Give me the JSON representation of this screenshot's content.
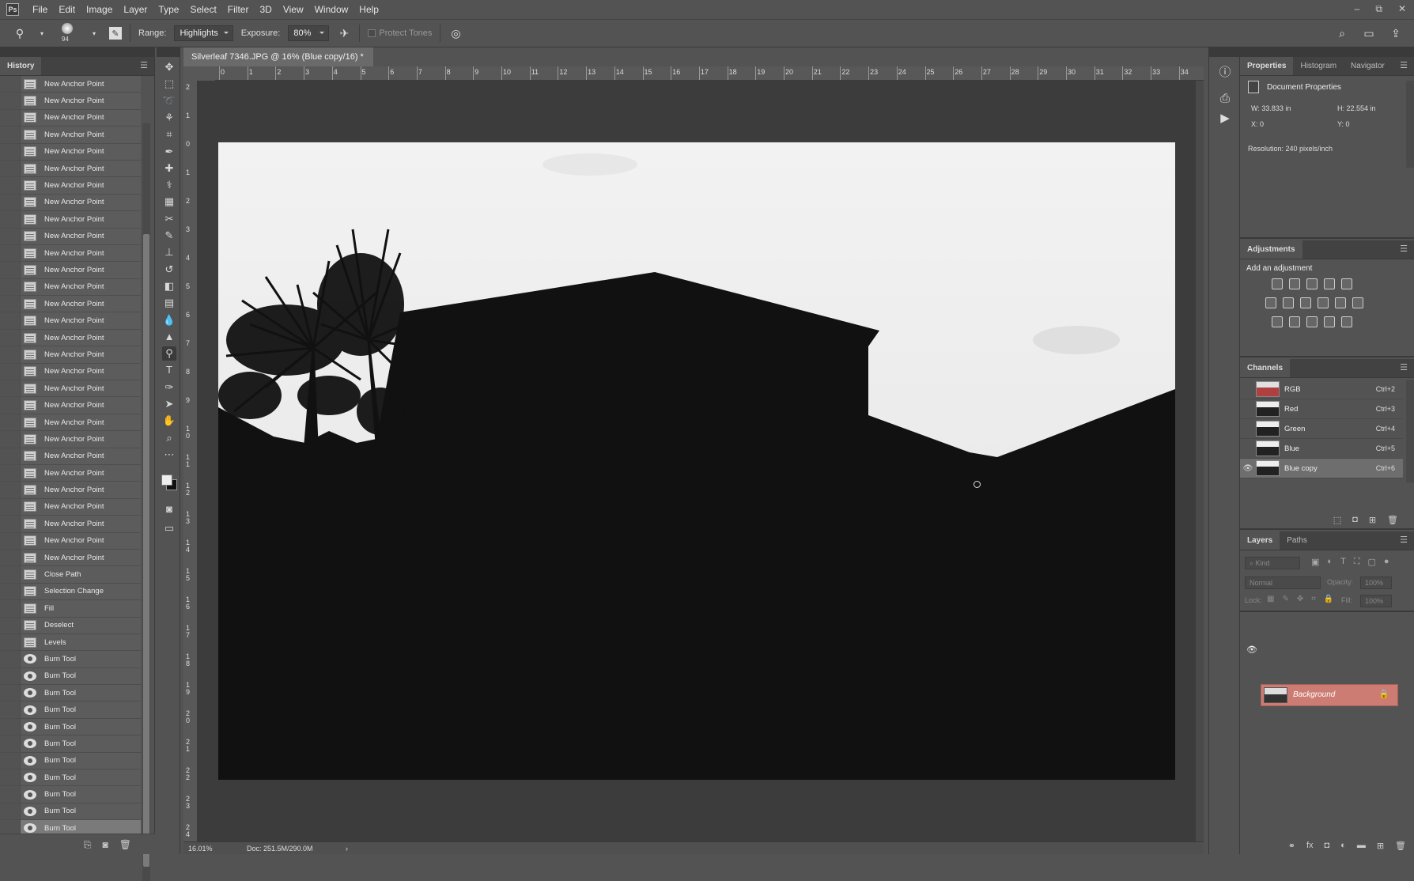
{
  "menubar": {
    "logo": "Ps",
    "items": [
      "File",
      "Edit",
      "Image",
      "Layer",
      "Type",
      "Select",
      "Filter",
      "3D",
      "View",
      "Window",
      "Help"
    ],
    "window_controls": [
      "–",
      "⧉",
      "✕"
    ]
  },
  "options": {
    "brush_size": "94",
    "range_label": "Range:",
    "range_value": "Highlights",
    "exposure_label": "Exposure:",
    "exposure_value": "80%",
    "protect_tones": "Protect Tones"
  },
  "history": {
    "tab": "History",
    "items": [
      {
        "label": "New Anchor Point",
        "icon": "doc"
      },
      {
        "label": "New Anchor Point",
        "icon": "doc"
      },
      {
        "label": "New Anchor Point",
        "icon": "doc"
      },
      {
        "label": "New Anchor Point",
        "icon": "doc"
      },
      {
        "label": "New Anchor Point",
        "icon": "doc"
      },
      {
        "label": "New Anchor Point",
        "icon": "doc"
      },
      {
        "label": "New Anchor Point",
        "icon": "doc"
      },
      {
        "label": "New Anchor Point",
        "icon": "doc"
      },
      {
        "label": "New Anchor Point",
        "icon": "doc"
      },
      {
        "label": "New Anchor Point",
        "icon": "doc"
      },
      {
        "label": "New Anchor Point",
        "icon": "doc"
      },
      {
        "label": "New Anchor Point",
        "icon": "doc"
      },
      {
        "label": "New Anchor Point",
        "icon": "doc"
      },
      {
        "label": "New Anchor Point",
        "icon": "doc"
      },
      {
        "label": "New Anchor Point",
        "icon": "doc"
      },
      {
        "label": "New Anchor Point",
        "icon": "doc"
      },
      {
        "label": "New Anchor Point",
        "icon": "doc"
      },
      {
        "label": "New Anchor Point",
        "icon": "doc"
      },
      {
        "label": "New Anchor Point",
        "icon": "doc"
      },
      {
        "label": "New Anchor Point",
        "icon": "doc"
      },
      {
        "label": "New Anchor Point",
        "icon": "doc"
      },
      {
        "label": "New Anchor Point",
        "icon": "doc"
      },
      {
        "label": "New Anchor Point",
        "icon": "doc"
      },
      {
        "label": "New Anchor Point",
        "icon": "doc"
      },
      {
        "label": "New Anchor Point",
        "icon": "doc"
      },
      {
        "label": "New Anchor Point",
        "icon": "doc"
      },
      {
        "label": "New Anchor Point",
        "icon": "doc"
      },
      {
        "label": "New Anchor Point",
        "icon": "doc"
      },
      {
        "label": "New Anchor Point",
        "icon": "doc"
      },
      {
        "label": "Close Path",
        "icon": "doc"
      },
      {
        "label": "Selection Change",
        "icon": "doc"
      },
      {
        "label": "Fill",
        "icon": "doc"
      },
      {
        "label": "Deselect",
        "icon": "doc"
      },
      {
        "label": "Levels",
        "icon": "doc"
      },
      {
        "label": "Burn Tool",
        "icon": "brush"
      },
      {
        "label": "Burn Tool",
        "icon": "brush"
      },
      {
        "label": "Burn Tool",
        "icon": "brush"
      },
      {
        "label": "Burn Tool",
        "icon": "brush"
      },
      {
        "label": "Burn Tool",
        "icon": "brush"
      },
      {
        "label": "Burn Tool",
        "icon": "brush"
      },
      {
        "label": "Burn Tool",
        "icon": "brush"
      },
      {
        "label": "Burn Tool",
        "icon": "brush"
      },
      {
        "label": "Burn Tool",
        "icon": "brush"
      },
      {
        "label": "Burn Tool",
        "icon": "brush"
      },
      {
        "label": "Burn Tool",
        "icon": "brush",
        "selected": true
      }
    ]
  },
  "document": {
    "tab_title": "Silverleaf 7346.JPG @ 16% (Blue copy/16) *",
    "zoom": "16.01%",
    "doc_size": "Doc: 251.5M/290.0M",
    "ruler_top": [
      "0",
      "1",
      "2",
      "3",
      "4",
      "5",
      "6",
      "7",
      "8",
      "9",
      "10",
      "11",
      "12",
      "13",
      "14",
      "15",
      "16",
      "17",
      "18",
      "19",
      "20",
      "21",
      "22",
      "23",
      "24",
      "25",
      "26",
      "27",
      "28",
      "29",
      "30",
      "31",
      "32",
      "33",
      "34"
    ],
    "ruler_left": [
      "2",
      "1",
      "0",
      "1",
      "2",
      "3",
      "4",
      "5",
      "6",
      "7",
      "8",
      "9",
      "1 0",
      "1 1",
      "1 2",
      "1 3",
      "1 4",
      "1 5",
      "1 6",
      "1 7",
      "1 8",
      "1 9",
      "2 0",
      "2 1",
      "2 2",
      "2 3",
      "2 4"
    ]
  },
  "properties": {
    "tabs": [
      "Properties",
      "Histogram",
      "Navigator"
    ],
    "header": "Document Properties",
    "w_label": "W:",
    "w_value": "33.833 in",
    "h_label": "H:",
    "h_value": "22.554 in",
    "x_label": "X:",
    "x_value": "0",
    "y_label": "Y:",
    "y_value": "0",
    "resolution": "Resolution: 240 pixels/inch"
  },
  "adjustments": {
    "tab": "Adjustments",
    "subtitle": "Add an adjustment"
  },
  "channels": {
    "tab": "Channels",
    "rows": [
      {
        "name": "RGB",
        "shortcut": "Ctrl+2",
        "visible": false,
        "thumb": "color"
      },
      {
        "name": "Red",
        "shortcut": "Ctrl+3",
        "visible": false,
        "thumb": "gray"
      },
      {
        "name": "Green",
        "shortcut": "Ctrl+4",
        "visible": false,
        "thumb": "gray"
      },
      {
        "name": "Blue",
        "shortcut": "Ctrl+5",
        "visible": false,
        "thumb": "gray"
      },
      {
        "name": "Blue copy",
        "shortcut": "Ctrl+6",
        "visible": true,
        "thumb": "gray",
        "selected": true
      }
    ]
  },
  "layers": {
    "tabs": [
      "Layers",
      "Paths"
    ],
    "kind_placeholder": "Kind",
    "blend_mode": "Normal",
    "opacity_label": "Opacity:",
    "opacity_value": "100%",
    "lock_label": "Lock:",
    "fill_label": "Fill:",
    "fill_value": "100%",
    "layer_name": "Background",
    "layer_color": "#cd7c74"
  }
}
